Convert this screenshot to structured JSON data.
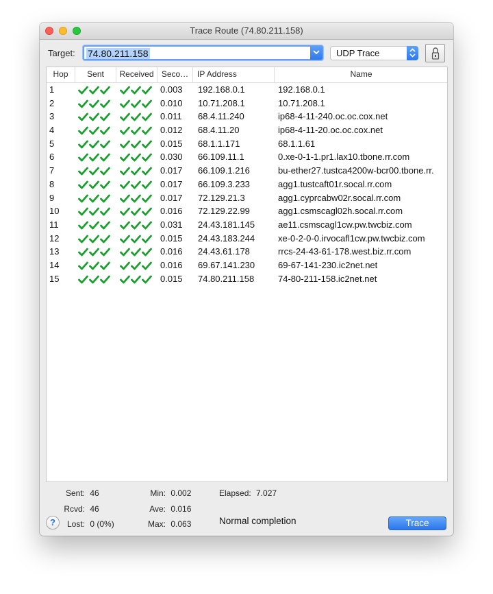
{
  "window": {
    "title": "Trace Route (74.80.211.158)"
  },
  "toolbar": {
    "target_label": "Target:",
    "target_value": "74.80.211.158",
    "trace_type": "UDP Trace",
    "lock_icon": "lock-icon"
  },
  "table": {
    "columns": [
      "Hop",
      "Sent",
      "Received",
      "Seco…",
      "IP Address",
      "Name"
    ],
    "rows": [
      {
        "hop": "1",
        "sent": 3,
        "received": 3,
        "seconds": "0.003",
        "ip": "192.168.0.1",
        "name": "192.168.0.1"
      },
      {
        "hop": "2",
        "sent": 3,
        "received": 3,
        "seconds": "0.010",
        "ip": "10.71.208.1",
        "name": "10.71.208.1"
      },
      {
        "hop": "3",
        "sent": 3,
        "received": 3,
        "seconds": "0.011",
        "ip": "68.4.11.240",
        "name": "ip68-4-11-240.oc.oc.cox.net"
      },
      {
        "hop": "4",
        "sent": 3,
        "received": 3,
        "seconds": "0.012",
        "ip": "68.4.11.20",
        "name": "ip68-4-11-20.oc.oc.cox.net"
      },
      {
        "hop": "5",
        "sent": 3,
        "received": 3,
        "seconds": "0.015",
        "ip": "68.1.1.171",
        "name": "68.1.1.61"
      },
      {
        "hop": "6",
        "sent": 3,
        "received": 3,
        "seconds": "0.030",
        "ip": "66.109.11.1",
        "name": "0.xe-0-1-1.pr1.lax10.tbone.rr.com"
      },
      {
        "hop": "7",
        "sent": 3,
        "received": 3,
        "seconds": "0.017",
        "ip": "66.109.1.216",
        "name": "bu-ether27.tustca4200w-bcr00.tbone.rr."
      },
      {
        "hop": "8",
        "sent": 3,
        "received": 3,
        "seconds": "0.017",
        "ip": "66.109.3.233",
        "name": "agg1.tustcaft01r.socal.rr.com"
      },
      {
        "hop": "9",
        "sent": 3,
        "received": 3,
        "seconds": "0.017",
        "ip": "72.129.21.3",
        "name": "agg1.cyprcabw02r.socal.rr.com"
      },
      {
        "hop": "10",
        "sent": 3,
        "received": 3,
        "seconds": "0.016",
        "ip": "72.129.22.99",
        "name": "agg1.csmscagl02h.socal.rr.com"
      },
      {
        "hop": "11",
        "sent": 3,
        "received": 3,
        "seconds": "0.031",
        "ip": "24.43.181.145",
        "name": "ae11.csmscagl1cw.pw.twcbiz.com"
      },
      {
        "hop": "12",
        "sent": 3,
        "received": 3,
        "seconds": "0.015",
        "ip": "24.43.183.244",
        "name": "xe-0-2-0-0.irvocafl1cw.pw.twcbiz.com"
      },
      {
        "hop": "13",
        "sent": 3,
        "received": 3,
        "seconds": "0.016",
        "ip": "24.43.61.178",
        "name": "rrcs-24-43-61-178.west.biz.rr.com"
      },
      {
        "hop": "14",
        "sent": 3,
        "received": 3,
        "seconds": "0.016",
        "ip": "69.67.141.230",
        "name": "69-67-141-230.ic2net.net"
      },
      {
        "hop": "15",
        "sent": 3,
        "received": 3,
        "seconds": "0.015",
        "ip": "74.80.211.158",
        "name": "74-80-211-158.ic2net.net"
      }
    ]
  },
  "stats": {
    "sent_label": "Sent:",
    "sent_value": "46",
    "rcvd_label": "Rcvd:",
    "rcvd_value": "46",
    "lost_label": "Lost:",
    "lost_value": "0 (0%)",
    "min_label": "Min:",
    "min_value": "0.002",
    "ave_label": "Ave:",
    "ave_value": "0.016",
    "max_label": "Max:",
    "max_value": "0.063",
    "elapsed_label": "Elapsed:",
    "elapsed_value": "7.027"
  },
  "footer": {
    "completion_text": "Normal completion",
    "help_label": "?",
    "trace_button_label": "Trace"
  },
  "colors": {
    "accent": "#2f78eb",
    "check": "#1a9e2f"
  }
}
